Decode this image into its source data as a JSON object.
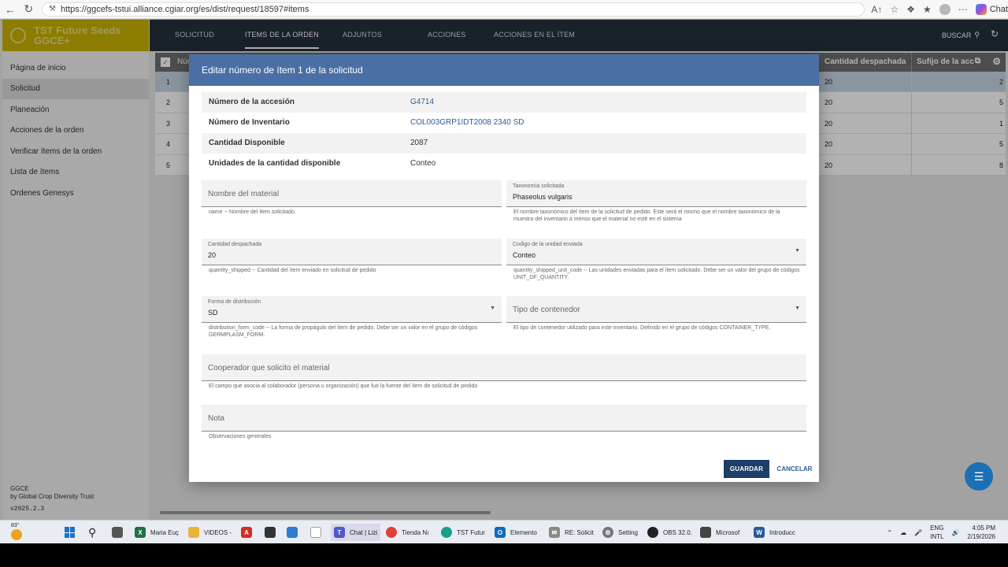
{
  "browser": {
    "url": "https://ggcefs-tstui.alliance.cgiar.org/es/dist/request/18597#items",
    "chat_label": "Chat"
  },
  "app": {
    "brand_line1": "TST Future Seeds",
    "brand_line2": "GGCE+",
    "tabs": [
      "SOLICITUD",
      "ITEMS DE LA ORDEN",
      "ADJUNTOS",
      "ACCIONES",
      "ACCIONES EN EL ÍTEM"
    ],
    "search_label": "BUSCAR",
    "sidebar": [
      "Página de inicio",
      "Solicitud",
      "Planeación",
      "Acciones de la orden",
      "Verificar ítems de la orden",
      "Lista de ítems",
      "Ordenes Genesys"
    ],
    "footer_org": "GGCE",
    "footer_by": "by Global Crop Diversity Trust",
    "version": "v2025.2.3"
  },
  "table": {
    "col_num": "Núm",
    "col_qty": "Cantidad despachada",
    "col_suffix": "Sufijo de la acc",
    "rows": [
      {
        "n": "1",
        "q": "20",
        "e": "2"
      },
      {
        "n": "2",
        "q": "20",
        "e": "5"
      },
      {
        "n": "3",
        "q": "20",
        "e": "1"
      },
      {
        "n": "4",
        "q": "20",
        "e": "5"
      },
      {
        "n": "5",
        "q": "20",
        "e": "8"
      }
    ]
  },
  "dialog": {
    "title": "Editar número de ítem 1 de la solicitud",
    "info": [
      {
        "k": "Número de la accesión",
        "v": "G4714"
      },
      {
        "k": "Número de Inventario",
        "v": "COL003GRP1IDT2008 2340 SD"
      },
      {
        "k": "Cantidad Disponible",
        "v": "2087"
      },
      {
        "k": "Unidades de la cantidad disponible",
        "v": "Conteo"
      }
    ],
    "material_placeholder": "Nombre del material",
    "material_hint": "name -- Nombre del ítem solicitado.",
    "taxonomy_label": "Taxonomía solicitada",
    "taxonomy_value": "Phaseolus vulgaris",
    "taxonomy_hint1": "El nombre taxonómico del ítem de la solicitud de pedido. Este será el mismo que el nombre taxonómico de la",
    "taxonomy_hint2": "muestra del inventario a menos que el material no esté en el sistema",
    "qty_label": "Cantidad despachada",
    "qty_value": "20",
    "qty_hint": "quantity_shipped -- Cantidad del ítem enviado en solicitud de pedido",
    "unit_label": "Codigo de la unidad enviada",
    "unit_value": "Conteo",
    "unit_hint1": "quantity_shipped_unit_code -- Las unidades enviadas para el ítem solicitado. Debe ser un valor del grupo de códigos",
    "unit_hint2": "UNIT_OF_QUANTITY.",
    "form_label": "Forma de distribución",
    "form_value": "SD",
    "form_hint1": "distribution_form_code -- La forma de propágulo del ítem de pedido. Debe ser un valor en el grupo de códigos",
    "form_hint2": "GERMPLASM_FORM.",
    "container_placeholder": "Tipo de contenedor",
    "container_hint": "El tipo de contenedor utilizado para este inventario. Definido en el grupo de códigos CONTAINER_TYPE.",
    "coop_placeholder": "Cooperador que solicito el material",
    "coop_hint": "El campo que asocia al colaborador (persona u organización) que fue la fuente del ítem de solicitud de pedido",
    "note_placeholder": "Nota",
    "note_hint": "Observaciones generales",
    "save_label": "GUARDAR",
    "cancel_label": "CANCELAR"
  },
  "taskbar": {
    "temp": "83°",
    "items": [
      "Maria Euç",
      "VIDEOS -",
      "Chat | Lizi",
      "Tienda Nı",
      "TST Futur",
      "Elemento",
      "RE: Solicit",
      "Setting",
      "OBS 32.0.",
      "Microsof",
      "Introducc"
    ],
    "lang1": "ENG",
    "lang2": "INTL",
    "time": "4:05 PM",
    "date": "2/19/2026"
  }
}
